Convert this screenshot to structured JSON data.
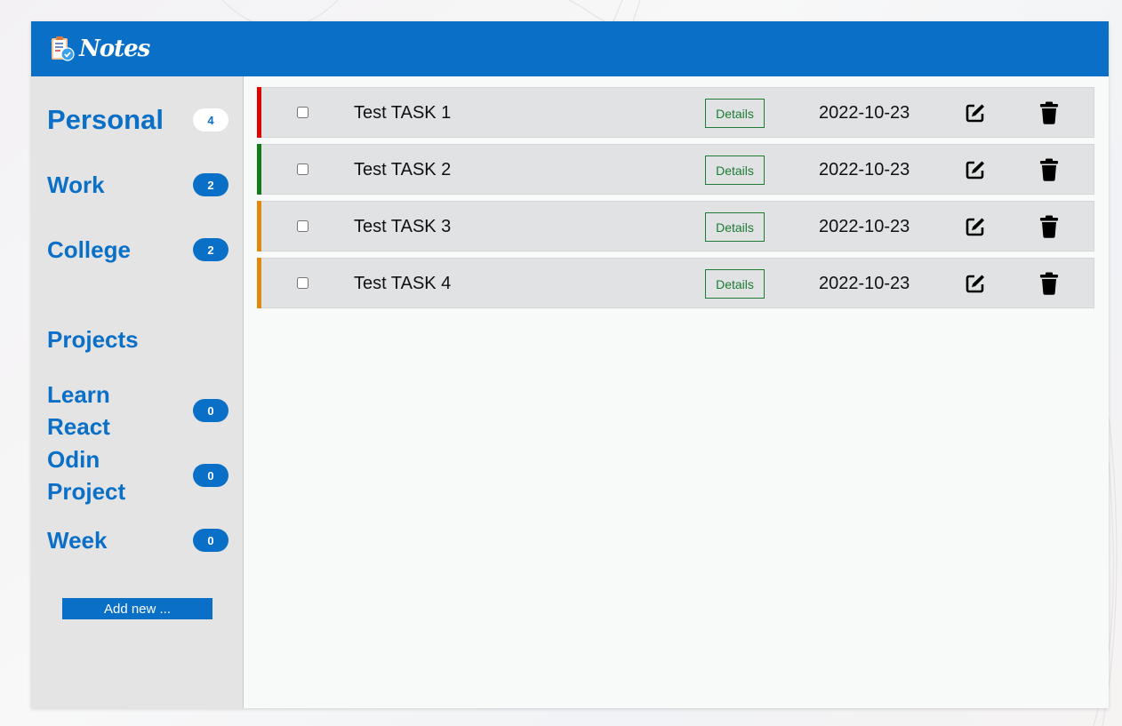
{
  "app": {
    "name": "Notes",
    "icon": "notepad-check-icon",
    "accent": "#0a6fc7"
  },
  "sidebar": {
    "categories": [
      {
        "label": "Personal",
        "count": "4",
        "active": true
      },
      {
        "label": "Work",
        "count": "2"
      },
      {
        "label": "College",
        "count": "2"
      }
    ],
    "projects_heading": "Projects",
    "projects": [
      {
        "label_line1": "Learn",
        "label_line2": "React",
        "count": "0"
      },
      {
        "label_line1": "Odin",
        "label_line2": "Project",
        "count": "0"
      },
      {
        "label": "Week",
        "count": "0"
      }
    ],
    "add_new_label": "Add new ..."
  },
  "tasks": [
    {
      "title": "Test TASK 1",
      "details_label": "Details",
      "date": "2022-10-23",
      "priority_color": "#e00000"
    },
    {
      "title": "Test TASK 2",
      "details_label": "Details",
      "date": "2022-10-23",
      "priority_color": "#137a18"
    },
    {
      "title": "Test TASK 3",
      "details_label": "Details",
      "date": "2022-10-23",
      "priority_color": "#e0890c"
    },
    {
      "title": "Test TASK 4",
      "details_label": "Details",
      "date": "2022-10-23",
      "priority_color": "#e0890c"
    }
  ],
  "icons": {
    "edit": "edit-icon",
    "delete": "trash-icon"
  }
}
